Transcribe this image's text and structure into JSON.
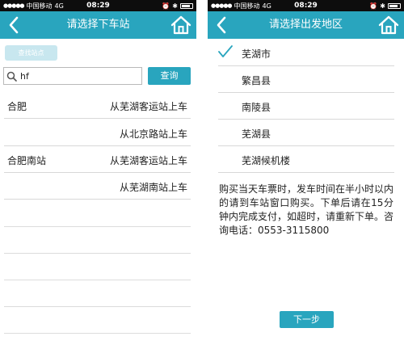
{
  "status_bar": {
    "carrier": "中国移动",
    "network": "4G",
    "time": "08:29"
  },
  "left_screen": {
    "title": "请选择下车站",
    "search_stations_label": "查找站点",
    "search": {
      "value": "hf",
      "placeholder": ""
    },
    "query_button": "查询",
    "results": [
      {
        "city": "合肥",
        "station": "从芜湖客运站上车"
      },
      {
        "city": "",
        "station": "从北京路站上车"
      },
      {
        "city": "合肥南站",
        "station": "从芜湖客运站上车"
      },
      {
        "city": "",
        "station": "从芜湖南站上车"
      }
    ]
  },
  "right_screen": {
    "title": "请选择出发地区",
    "regions": [
      {
        "label": "芜湖市",
        "selected": true
      },
      {
        "label": "繁昌县",
        "selected": false
      },
      {
        "label": "南陵县",
        "selected": false
      },
      {
        "label": "芜湖县",
        "selected": false
      },
      {
        "label": "芜湖候机楼",
        "selected": false
      }
    ],
    "notice": "购买当天车票时，发车时间在半小时以内的请到车站窗口购买。下单后请在15分钟内完成支付，如超时，请重新下单。咨询电话：0553-3115800",
    "next_button": "下一步"
  },
  "colors": {
    "accent": "#29a5be",
    "light_accent": "#c8e7ef",
    "status_bar": "#0d0d0d",
    "divider": "#d8d8d8"
  },
  "icons": {
    "back": "chevron-left-icon",
    "home": "home-icon",
    "search": "search-icon",
    "check": "check-icon"
  }
}
